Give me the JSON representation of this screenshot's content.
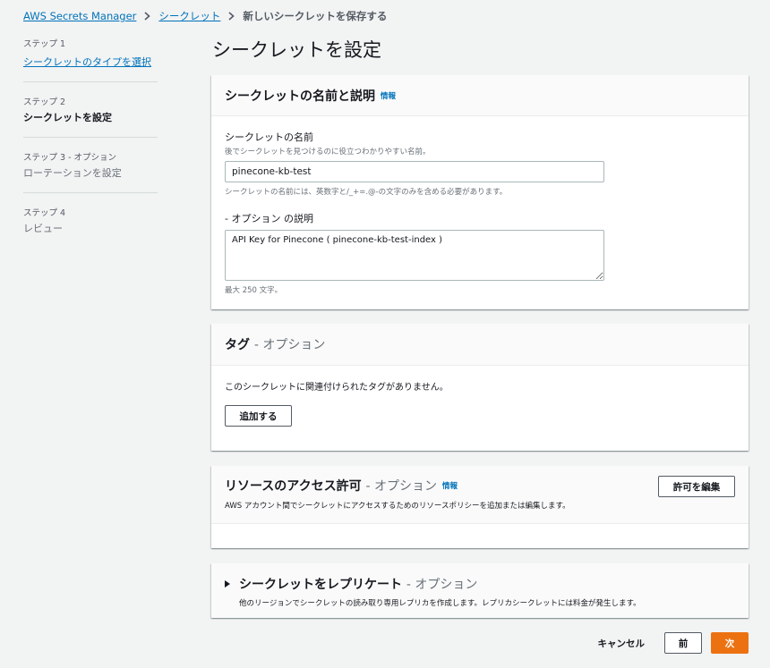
{
  "breadcrumb": {
    "service": "AWS Secrets Manager",
    "secrets": "シークレット",
    "current": "新しいシークレットを保存する"
  },
  "sidebar": {
    "steps": [
      {
        "label": "ステップ 1",
        "title": "シークレットのタイプを選択"
      },
      {
        "label": "ステップ 2",
        "title": "シークレットを設定"
      },
      {
        "label": "ステップ 3 - オプション",
        "title": "ローテーションを設定"
      },
      {
        "label": "ステップ 4",
        "title": "レビュー"
      }
    ]
  },
  "page": {
    "title": "シークレットを設定"
  },
  "name_panel": {
    "title": "シークレットの名前と説明",
    "info": "情報",
    "name_label": "シークレットの名前",
    "name_desc": "後でシークレットを見つけるのに役立つわかりやすい名前。",
    "name_value": "pinecone-kb-test",
    "name_constraint": "シークレットの名前には、英数字と/_+=.@-の文字のみを含める必要があります。",
    "desc_label": "- オプション の説明",
    "desc_value": "API Key for Pinecone ( pinecone-kb-test-index )",
    "desc_constraint": "最大 250 文字。"
  },
  "tags_panel": {
    "title": "タグ",
    "optional": "- オプション",
    "empty_text": "このシークレットに関連付けられたタグがありません。",
    "add_button": "追加する"
  },
  "resource_panel": {
    "title": "リソースのアクセス許可",
    "optional": "- オプション",
    "info": "情報",
    "desc": "AWS アカウント間でシークレットにアクセスするためのリソースポリシーを追加または編集します。",
    "edit_button": "許可を編集"
  },
  "replicate_panel": {
    "title": "シークレットをレプリケート",
    "optional": "- オプション",
    "desc": "他のリージョンでシークレットの読み取り専用レプリカを作成します。レプリカシークレットには料金が発生します。"
  },
  "footer": {
    "cancel": "キャンセル",
    "previous": "前",
    "next": "次"
  }
}
